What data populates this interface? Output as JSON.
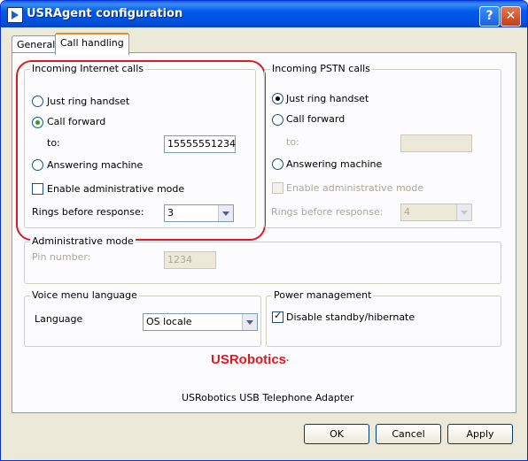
{
  "window": {
    "title": "USRAgent configuration",
    "help": "?",
    "close": "✕"
  },
  "tabs": [
    {
      "label": "General"
    },
    {
      "label": "Call handling"
    }
  ],
  "internet": {
    "legend": "Incoming Internet calls",
    "ring": "Just ring handset",
    "forward": "Call forward",
    "to_label": "to:",
    "to_value": "15555551234",
    "answering": "Answering machine",
    "admin": "Enable administrative mode",
    "rings_label": "Rings before response:",
    "rings_value": "3"
  },
  "pstn": {
    "legend": "Incoming PSTN calls",
    "ring": "Just ring handset",
    "forward": "Call forward",
    "to_label": "to:",
    "answering": "Answering machine",
    "admin": "Enable administrative mode",
    "rings_label": "Rings before response:",
    "rings_value": "4"
  },
  "admin_mode": {
    "legend": "Administrative mode",
    "pin_label": "Pin number:",
    "pin_value": "1234"
  },
  "voice": {
    "legend": "Voice menu language",
    "language_label": "Language",
    "language_value": "OS locale"
  },
  "power": {
    "legend": "Power management",
    "disable": "Disable standby/hibernate"
  },
  "brand": {
    "name": "USRobotics",
    "mark": "·"
  },
  "caption": "USRobotics USB Telephone Adapter",
  "buttons": {
    "ok": "OK",
    "cancel": "Cancel",
    "apply": "Apply"
  },
  "colors": {
    "title_bar": "#0058ee",
    "highlight": "#e0181f",
    "brand": "#e0181f"
  }
}
